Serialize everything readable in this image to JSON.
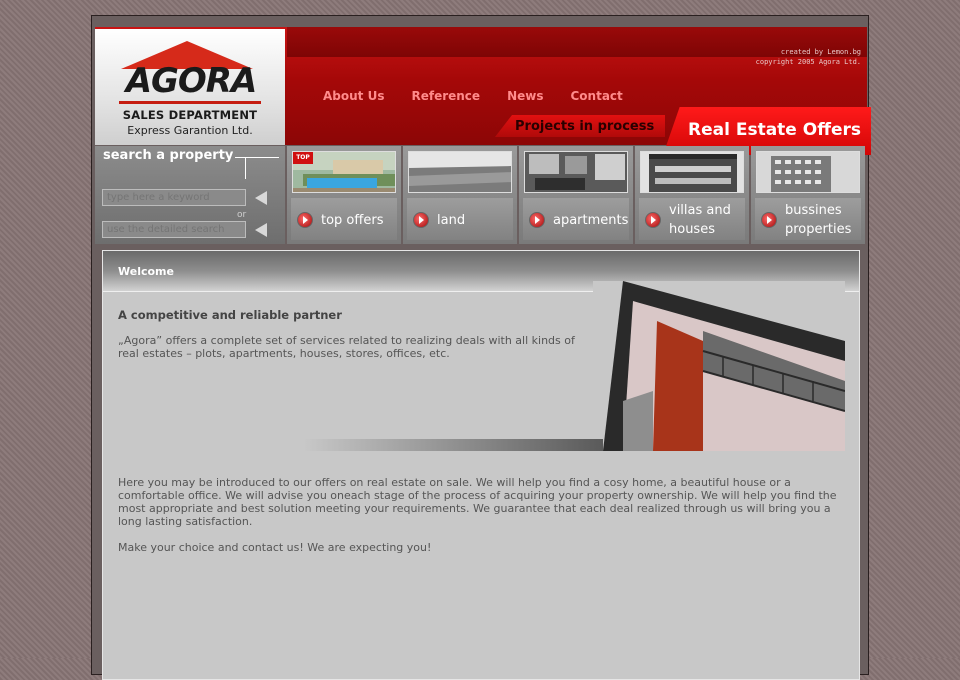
{
  "header": {
    "logo": {
      "brand": "AGORA",
      "department": "SALES DEPARTMENT",
      "tagline": "Express Garantion Ltd."
    },
    "credits": {
      "created_by": "created by Lemon.bg",
      "copyright": "copyright 2005 Agora Ltd."
    },
    "nav": [
      "About Us",
      "Reference",
      "News",
      "Contact"
    ],
    "tabs": {
      "projects": "Projects in process",
      "offers": "Real Estate Offers"
    }
  },
  "search": {
    "title": "search a property",
    "keyword_placeholder": "type here a keyword",
    "or_label": "or",
    "detailed_label": "use the detailed search"
  },
  "categories": [
    {
      "label": "top offers",
      "badge": "TOP",
      "thumb": "pool-villa"
    },
    {
      "label": "land",
      "thumb": "field-landscape"
    },
    {
      "label": "apartments",
      "thumb": "interior-room"
    },
    {
      "label": "villas and houses",
      "thumb": "traditional-house"
    },
    {
      "label": "bussines properties",
      "thumb": "office-building"
    }
  ],
  "content": {
    "section_title": "Welcome",
    "partner_heading": "A competitive and reliable partner",
    "intro": "„Agora” offers a complete set of services related to realizing deals with all kinds of real estates – plots, apartments, houses, stores, offices, etc.",
    "body": "Here you may be introduced to our offers on real estate on sale. We will help you find a cosy home, a beautiful house or a comfortable office. We will advise you oneach stage of the process of acquiring your property ownership. We will help you find the most appropriate and best solution meeting your requirements. We guarantee that each deal realized through us will bring you a long lasting satisfaction.",
    "closing": "Make your choice and contact us! We are expecting you!"
  },
  "colors": {
    "brand_red": "#d20606",
    "nav_link": "#ff8b8b",
    "panel_gray": "#c8c8c8"
  }
}
